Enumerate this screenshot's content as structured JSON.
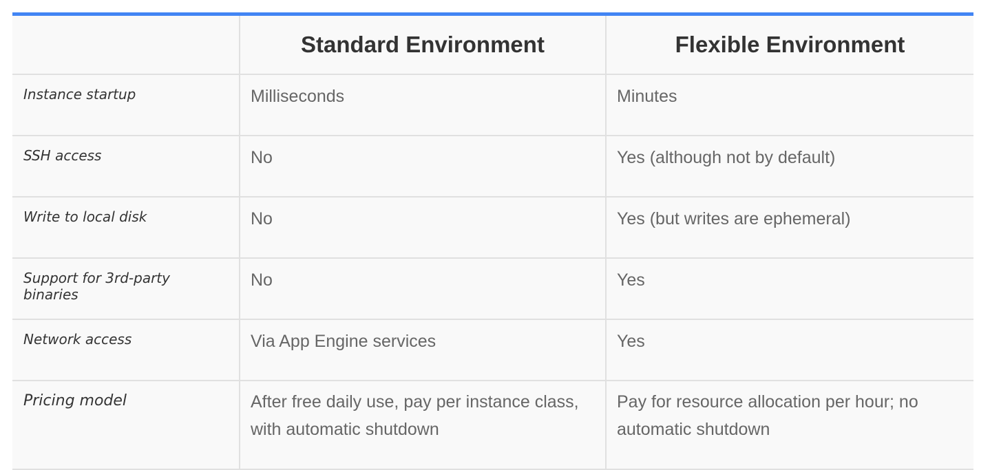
{
  "table": {
    "headers": [
      "",
      "Standard Environment",
      "Flexible Environment"
    ],
    "rows": [
      {
        "label": "Instance startup",
        "standard": "Milliseconds",
        "flexible": "Minutes"
      },
      {
        "label": "SSH access",
        "standard": "No",
        "flexible": "Yes (although not by default)"
      },
      {
        "label": "Write to local disk",
        "standard": "No",
        "flexible": "Yes (but writes are ephemeral)"
      },
      {
        "label": "Support for 3rd-party binaries",
        "standard": "No",
        "flexible": "Yes"
      },
      {
        "label": "Network access",
        "standard": "Via App Engine services",
        "flexible": "Yes"
      },
      {
        "label": "Pricing model",
        "standard": "After free daily use, pay per instance class, with automatic shutdown",
        "flexible": "Pay for resource allocation per hour; no automatic shutdown"
      }
    ]
  },
  "colors": {
    "accent_border": "#4285f4",
    "header_text": "#333333",
    "cell_text": "#666666",
    "table_background": "#f9f9f9",
    "grid_line": "#e0e0e0"
  }
}
